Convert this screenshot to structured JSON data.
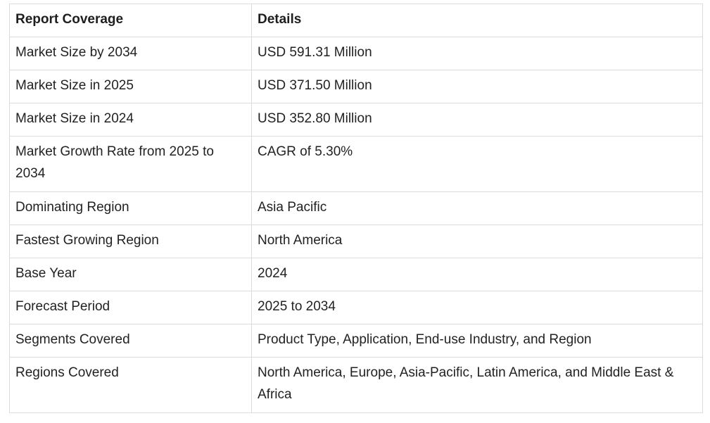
{
  "table": {
    "headers": [
      "Report Coverage",
      "Details"
    ],
    "rows": [
      [
        "Market Size by 2034",
        "USD 591.31 Million"
      ],
      [
        "Market Size in 2025",
        "USD 371.50 Million"
      ],
      [
        "Market Size in 2024",
        "USD 352.80 Million"
      ],
      [
        "Market Growth Rate from 2025 to 2034",
        "CAGR of 5.30%"
      ],
      [
        "Dominating Region",
        "Asia Pacific"
      ],
      [
        "Fastest Growing Region",
        "North America"
      ],
      [
        "Base Year",
        "2024"
      ],
      [
        "Forecast Period",
        "2025 to 2034"
      ],
      [
        "Segments Covered",
        "Product Type, Application, End-use Industry, and Region"
      ],
      [
        "Regions Covered",
        "North America, Europe, Asia-Pacific, Latin America, and Middle East & Africa"
      ]
    ]
  }
}
